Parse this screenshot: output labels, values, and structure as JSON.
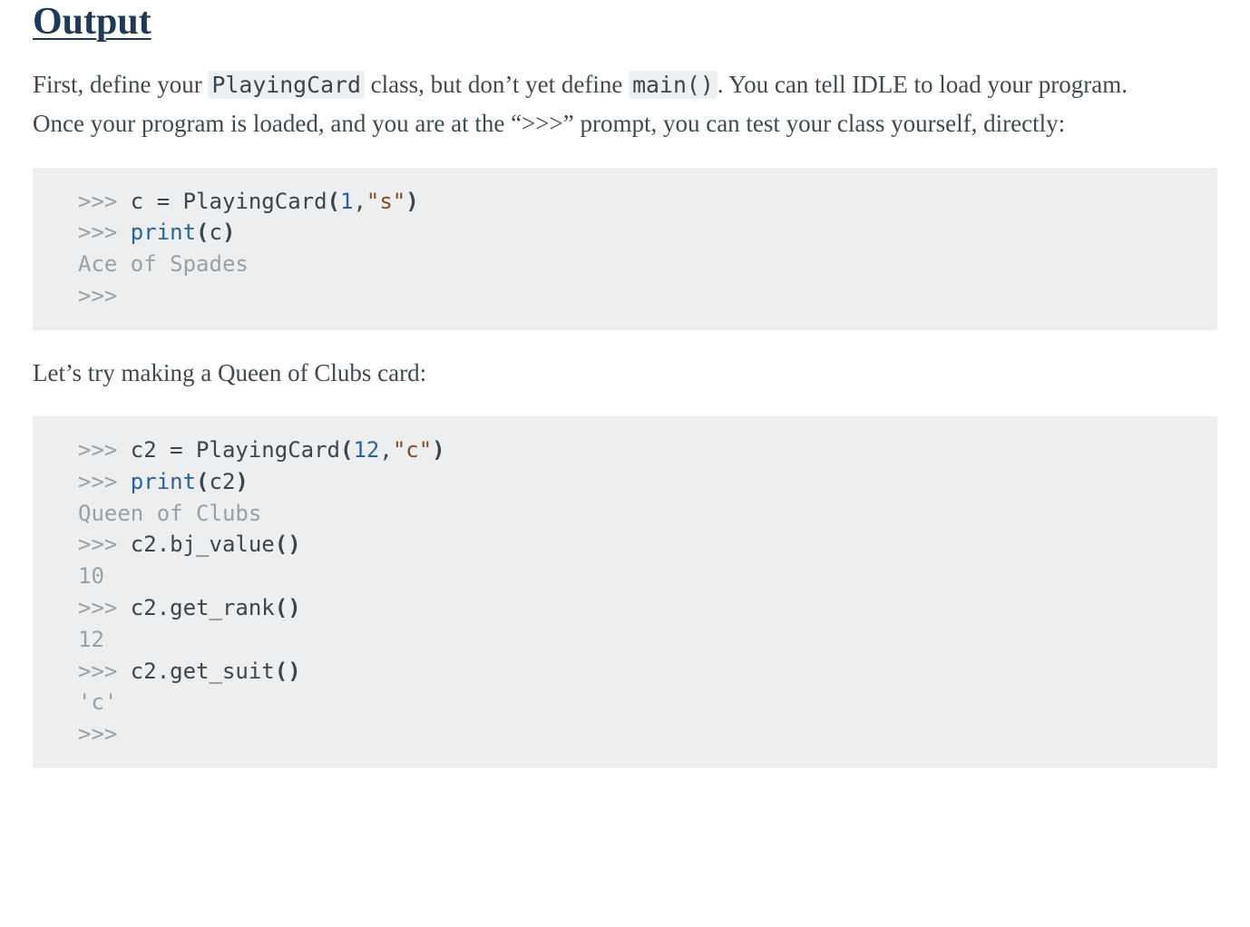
{
  "heading": "Output",
  "para1": {
    "t1": "First, define your ",
    "code1": "PlayingCard",
    "t2": " class, but don’t yet define ",
    "code2": "main()",
    "t3": ". You can tell IDLE to load your program. Once your program is loaded, and you are at the “>>>” prompt, you can test your class yourself, directly:"
  },
  "block1": {
    "p1": ">>> ",
    "l1a": "c ",
    "l1b": "=",
    "l1c": " PlayingCard",
    "l1d": "(",
    "l1e": "1",
    "l1f": ",",
    "l1g": "\"s\"",
    "l1h": ")",
    "p2": ">>> ",
    "l2a": "print",
    "l2b": "(",
    "l2c": "c",
    "l2d": ")",
    "o1": "Ace of Spades",
    "p3": ">>>"
  },
  "para2": "Let’s try making a Queen of Clubs card:",
  "block2": {
    "p1": ">>> ",
    "l1a": "c2 ",
    "l1b": "=",
    "l1c": " PlayingCard",
    "l1d": "(",
    "l1e": "12",
    "l1f": ",",
    "l1g": "\"c\"",
    "l1h": ")",
    "p2": ">>> ",
    "l2a": "print",
    "l2b": "(",
    "l2c": "c2",
    "l2d": ")",
    "o1": "Queen of Clubs",
    "p3": ">>> ",
    "l3a": "c2",
    "l3b": ".",
    "l3c": "bj_value",
    "l3d": "()",
    "o2": "10",
    "p4": ">>> ",
    "l4a": "c2",
    "l4b": ".",
    "l4c": "get_rank",
    "l4d": "()",
    "o3": "12",
    "p5": ">>> ",
    "l5a": "c2",
    "l5b": ".",
    "l5c": "get_suit",
    "l5d": "()",
    "o4": "'c'",
    "p6": ">>>"
  }
}
